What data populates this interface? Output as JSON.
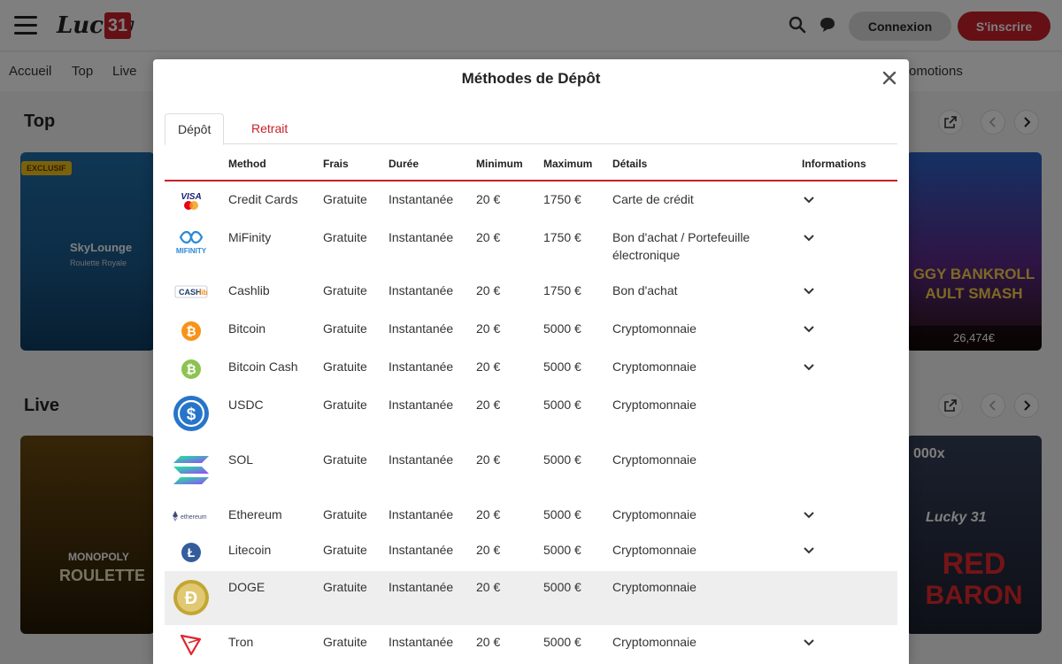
{
  "header": {
    "brand_word": "Lucky",
    "brand_num": "31",
    "login_label": "Connexion",
    "signup_label": "S'inscrire"
  },
  "nav": {
    "items": [
      "Accueil",
      "Top",
      "Live"
    ],
    "promotions_partial": "omotions"
  },
  "sections": {
    "top_title": "Top",
    "live_title": "Live"
  },
  "cards": {
    "sky_badge": "EXCLUSIF",
    "sky_title": "SkyLounge",
    "sky_subtitle": "Roulette Royale",
    "mono_title": "MONOPOLY",
    "mono_subtitle": "ROULETTE",
    "piggy_title1": "GGY BANKROLL",
    "piggy_title2": "AULT SMASH",
    "piggy_amount": "26,474€",
    "red_multiplier": "000x",
    "red_brand": "Lucky 31",
    "red_title1": "RED",
    "red_title2": "BARON"
  },
  "modal": {
    "title": "Méthodes de Dépôt",
    "tabs": [
      "Dépôt",
      "Retrait"
    ],
    "columns": [
      "Method",
      "Frais",
      "Durée",
      "Minimum",
      "Maximum",
      "Détails",
      "Informations"
    ],
    "rows": [
      {
        "method": "Credit Cards",
        "frais": "Gratuite",
        "duree": "Instantanée",
        "min": "20 €",
        "max": "1750 €",
        "details": "Carte de crédit",
        "expandable": true,
        "logo": "visa-mastercard-icon"
      },
      {
        "method": "MiFinity",
        "frais": "Gratuite",
        "duree": "Instantanée",
        "min": "20 €",
        "max": "1750 €",
        "details": "Bon d'achat / Portefeuille électronique",
        "expandable": true,
        "logo": "mifinity-icon"
      },
      {
        "method": "Cashlib",
        "frais": "Gratuite",
        "duree": "Instantanée",
        "min": "20 €",
        "max": "1750 €",
        "details": "Bon d'achat",
        "expandable": true,
        "logo": "cashlib-icon"
      },
      {
        "method": "Bitcoin",
        "frais": "Gratuite",
        "duree": "Instantanée",
        "min": "20 €",
        "max": "5000 €",
        "details": "Cryptomonnaie",
        "expandable": true,
        "logo": "bitcoin-icon"
      },
      {
        "method": "Bitcoin Cash",
        "frais": "Gratuite",
        "duree": "Instantanée",
        "min": "20 €",
        "max": "5000 €",
        "details": "Cryptomonnaie",
        "expandable": true,
        "logo": "bitcoin-cash-icon"
      },
      {
        "method": "USDC",
        "frais": "Gratuite",
        "duree": "Instantanée",
        "min": "20 €",
        "max": "5000 €",
        "details": "Cryptomonnaie",
        "expandable": false,
        "logo": "usdc-icon"
      },
      {
        "method": "SOL",
        "frais": "Gratuite",
        "duree": "Instantanée",
        "min": "20 €",
        "max": "5000 €",
        "details": "Cryptomonnaie",
        "expandable": false,
        "logo": "solana-icon"
      },
      {
        "method": "Ethereum",
        "frais": "Gratuite",
        "duree": "Instantanée",
        "min": "20 €",
        "max": "5000 €",
        "details": "Cryptomonnaie",
        "expandable": true,
        "logo": "ethereum-icon"
      },
      {
        "method": "Litecoin",
        "frais": "Gratuite",
        "duree": "Instantanée",
        "min": "20 €",
        "max": "5000 €",
        "details": "Cryptomonnaie",
        "expandable": true,
        "logo": "litecoin-icon"
      },
      {
        "method": "DOGE",
        "frais": "Gratuite",
        "duree": "Instantanée",
        "min": "20 €",
        "max": "5000 €",
        "details": "Cryptomonnaie",
        "expandable": false,
        "logo": "dogecoin-icon",
        "highlighted": true
      },
      {
        "method": "Tron",
        "frais": "Gratuite",
        "duree": "Instantanée",
        "min": "20 €",
        "max": "5000 €",
        "details": "Cryptomonnaie",
        "expandable": true,
        "logo": "tron-icon"
      }
    ]
  },
  "colors": {
    "brand_red": "#c8202a",
    "bitcoin_orange": "#f7931a",
    "bch_green": "#8dc351",
    "usdc_blue": "#2775ca",
    "litecoin_blue": "#345d9d",
    "doge_gold": "#c2a633",
    "tron_red": "#e0262d",
    "mifinity_blue": "#2b89d8"
  }
}
